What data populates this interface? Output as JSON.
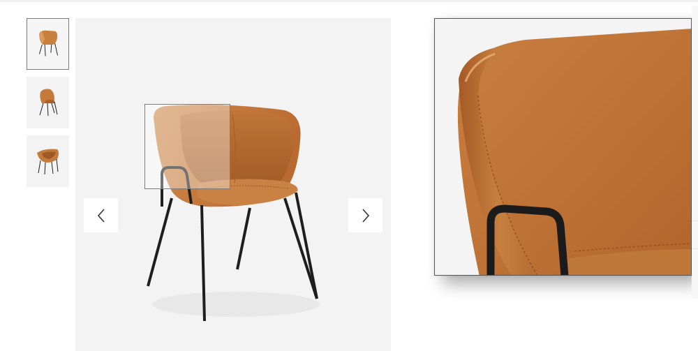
{
  "gallery": {
    "thumbnails": [
      {
        "icon": "chair-front-thumbnail-icon",
        "selected": true
      },
      {
        "icon": "chair-side-thumbnail-icon",
        "selected": false
      },
      {
        "icon": "chair-back-thumbnail-icon",
        "selected": false
      }
    ],
    "main_image": "chair-photo-icon",
    "prev_icon": "chevron-left-icon",
    "next_icon": "chevron-right-icon",
    "zoom_image": "chair-zoom-detail-icon"
  },
  "colors": {
    "leather": "#c77a3e",
    "leather_dark": "#a95e27",
    "leather_light": "#dd9a5e",
    "metal": "#1e1e1e",
    "background": "#f3f3f3"
  }
}
